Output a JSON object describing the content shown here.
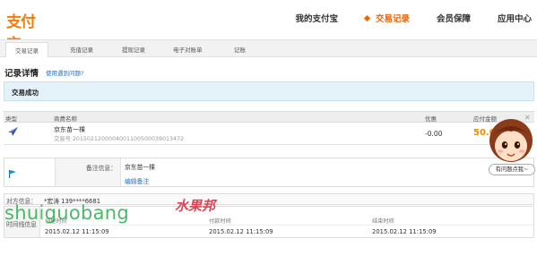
{
  "brand": {
    "logo_text": "支付宝",
    "accent": "#f37d0b"
  },
  "nav": {
    "items": [
      {
        "label": "我的支付宝",
        "active": false
      },
      {
        "label": "交易记录",
        "active": true
      },
      {
        "label": "会员保障",
        "active": false
      },
      {
        "label": "应用中心",
        "active": false
      }
    ]
  },
  "subnav": {
    "tabs": [
      {
        "label": "交易记录",
        "active": true
      },
      {
        "label": "充值记录",
        "active": false
      },
      {
        "label": "提现记录",
        "active": false
      },
      {
        "label": "电子对账单",
        "active": false
      },
      {
        "label": "记账",
        "active": false
      }
    ]
  },
  "section": {
    "title": "记录详情",
    "help_link": "使用遇到问题?"
  },
  "status": {
    "text": "交易成功"
  },
  "table": {
    "headers": {
      "type": "类型",
      "name": "商费名称",
      "discount": "优惠",
      "amount": "应付金额"
    },
    "row": {
      "type_icon": "plane-icon",
      "name": "京东苗一棵",
      "trade_no": "交易号 2015021200004001100500039013472",
      "discount": "-0.00",
      "amount": "50.0"
    }
  },
  "remark": {
    "icon": "flag-icon",
    "label": "备注信息：",
    "value": "京东苗一棵",
    "edit_link": "编辑备注"
  },
  "party": {
    "label": "对方信息：",
    "value": "*宏涛 139****6681"
  },
  "times": {
    "label": "时间线信息",
    "columns": [
      {
        "header": "创建时间",
        "value": "2015.02.12 11:15:09"
      },
      {
        "header": "付款时间",
        "value": "2015.02.12 11:15:09"
      },
      {
        "header": "结束时间",
        "value": "2015.02.12 11:15:09"
      }
    ]
  },
  "help_widget": {
    "bubble": "有问题点我~",
    "close": "✕"
  },
  "watermark": {
    "latin": "shuiguobang",
    "cn": "水果邦"
  }
}
